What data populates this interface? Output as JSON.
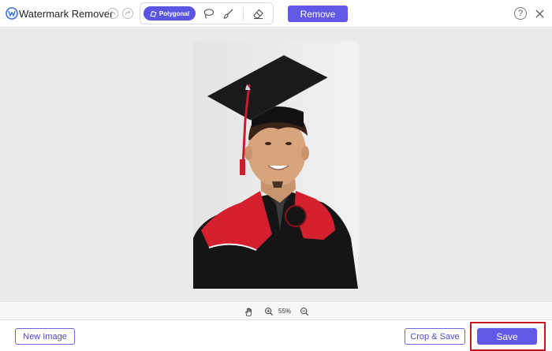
{
  "app": {
    "title": "Watermark Remover"
  },
  "toolbar": {
    "polygonal_label": "Polygonal",
    "remove_label": "Remove",
    "help_glyph": "?"
  },
  "canvas": {
    "zoom": "55%"
  },
  "footer": {
    "new_image_label": "New Image",
    "crop_save_label": "Crop & Save",
    "save_label": "Save"
  },
  "colors": {
    "accent": "#6159e6",
    "highlight": "#c8141c",
    "canvas_bg": "#eaeaea"
  },
  "icons": [
    "app-logo-icon",
    "undo-icon",
    "redo-icon",
    "polygonal-icon",
    "lasso-icon",
    "brush-icon",
    "eraser-icon",
    "help-icon",
    "close-icon",
    "hand-icon",
    "zoom-in-icon",
    "zoom-out-icon"
  ]
}
